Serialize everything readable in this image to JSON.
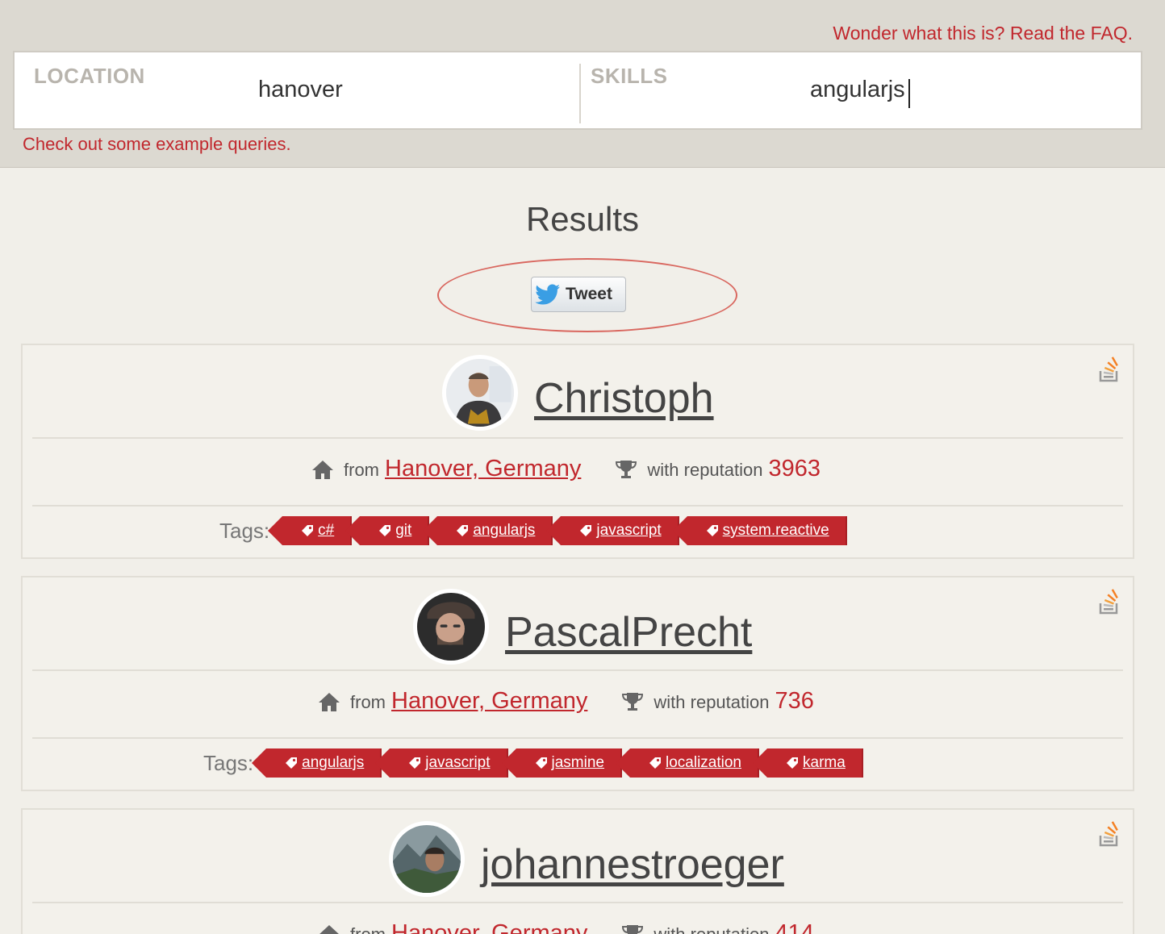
{
  "header": {
    "faq_link": "Wonder what this is? Read the FAQ.",
    "location_label": "LOCATION",
    "location_value": "hanover",
    "skills_label": "SKILLS",
    "skills_value": "angularjs",
    "examples_link": "Check out some example queries."
  },
  "results": {
    "title": "Results",
    "tweet_label": "Tweet"
  },
  "colors": {
    "accent": "#c1272d",
    "header_bg": "#dcd9d1",
    "page_bg": "#f1efe9"
  },
  "cards": [
    {
      "username": "Christoph",
      "from_label": "from",
      "location": "Hanover, Germany",
      "rep_label": "with reputation",
      "reputation": "3963",
      "tags_label": "Tags:",
      "tags": [
        "c#",
        "git",
        "angularjs",
        "javascript",
        "system.reactive"
      ]
    },
    {
      "username": "PascalPrecht",
      "from_label": "from",
      "location": "Hanover, Germany",
      "rep_label": "with reputation",
      "reputation": "736",
      "tags_label": "Tags:",
      "tags": [
        "angularjs",
        "javascript",
        "jasmine",
        "localization",
        "karma"
      ]
    },
    {
      "username": "johannestroeger",
      "from_label": "from",
      "location": "Hanover, Germany",
      "rep_label": "with reputation",
      "reputation": "414"
    }
  ]
}
